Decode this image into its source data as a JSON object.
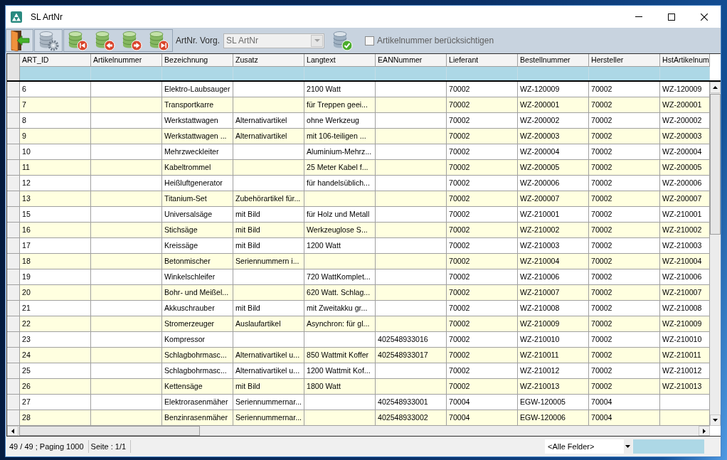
{
  "window": {
    "title": "SL ArtNr"
  },
  "toolbar": {
    "field_label": "ArtNr. Vorg.",
    "combo": {
      "value": "SL ArtNr",
      "disabled": true
    },
    "checkbox": {
      "label": "Artikelnummer berücksichtigen",
      "checked": false
    }
  },
  "table": {
    "columns": [
      "ART_ID",
      "Artikelnummer",
      "Bezeichnung",
      "Zusatz",
      "Langtext",
      "EANNummer",
      "Lieferant",
      "Bestellnummer",
      "Hersteller",
      "HstArtikelnum"
    ],
    "rows": [
      {
        "art_id": "6",
        "bezeichnung": "Elektro-Laubsauger",
        "langtext": "2100 Watt",
        "lieferant": "70002",
        "bestellnummer": "WZ-120009",
        "hersteller": "70002",
        "hst_artikelnum": "WZ-120009"
      },
      {
        "art_id": "7",
        "bezeichnung": "Transportkarre",
        "langtext": "für Treppen geei...",
        "lieferant": "70002",
        "bestellnummer": "WZ-200001",
        "hersteller": "70002",
        "hst_artikelnum": "WZ-200001"
      },
      {
        "art_id": "8",
        "bezeichnung": "Werkstattwagen",
        "zusatz": "Alternativartikel",
        "langtext": "ohne Werkzeug",
        "lieferant": "70002",
        "bestellnummer": "WZ-200002",
        "hersteller": "70002",
        "hst_artikelnum": "WZ-200002"
      },
      {
        "art_id": "9",
        "bezeichnung": "Werkstattwagen ...",
        "zusatz": "Alternativartikel",
        "langtext": "mit 106-teiligen ...",
        "lieferant": "70002",
        "bestellnummer": "WZ-200003",
        "hersteller": "70002",
        "hst_artikelnum": "WZ-200003"
      },
      {
        "art_id": "10",
        "bezeichnung": "Mehrzweckleiter",
        "langtext": "Aluminium-Mehrz...",
        "lieferant": "70002",
        "bestellnummer": "WZ-200004",
        "hersteller": "70002",
        "hst_artikelnum": "WZ-200004"
      },
      {
        "art_id": "11",
        "bezeichnung": "Kabeltrommel",
        "langtext": "25 Meter Kabel f...",
        "lieferant": "70002",
        "bestellnummer": "WZ-200005",
        "hersteller": "70002",
        "hst_artikelnum": "WZ-200005"
      },
      {
        "art_id": "12",
        "bezeichnung": "Heißluftgenerator",
        "langtext": "für handelsüblich...",
        "lieferant": "70002",
        "bestellnummer": "WZ-200006",
        "hersteller": "70002",
        "hst_artikelnum": "WZ-200006"
      },
      {
        "art_id": "13",
        "bezeichnung": "Titanium-Set",
        "zusatz": "Zubehörartikel für...",
        "lieferant": "70002",
        "bestellnummer": "WZ-200007",
        "hersteller": "70002",
        "hst_artikelnum": "WZ-200007"
      },
      {
        "art_id": "15",
        "bezeichnung": "Universalsäge",
        "zusatz": "mit Bild",
        "langtext": "für Holz und Metall",
        "lieferant": "70002",
        "bestellnummer": "WZ-210001",
        "hersteller": "70002",
        "hst_artikelnum": "WZ-210001"
      },
      {
        "art_id": "16",
        "bezeichnung": "Stichsäge",
        "zusatz": "mit Bild",
        "langtext": "Werkzeuglose S...",
        "lieferant": "70002",
        "bestellnummer": "WZ-210002",
        "hersteller": "70002",
        "hst_artikelnum": "WZ-210002"
      },
      {
        "art_id": "17",
        "bezeichnung": "Kreissäge",
        "zusatz": "mit Bild",
        "langtext": "1200 Watt",
        "lieferant": "70002",
        "bestellnummer": "WZ-210003",
        "hersteller": "70002",
        "hst_artikelnum": "WZ-210003"
      },
      {
        "art_id": "18",
        "bezeichnung": "Betonmischer",
        "zusatz": "Seriennummern i...",
        "lieferant": "70002",
        "bestellnummer": "WZ-210004",
        "hersteller": "70002",
        "hst_artikelnum": "WZ-210004"
      },
      {
        "art_id": "19",
        "bezeichnung": "Winkelschleifer",
        "langtext": "720 WattKomplet...",
        "lieferant": "70002",
        "bestellnummer": "WZ-210006",
        "hersteller": "70002",
        "hst_artikelnum": "WZ-210006"
      },
      {
        "art_id": "20",
        "bezeichnung": "Bohr- und Meißel...",
        "langtext": "620 Watt. Schlag...",
        "lieferant": "70002",
        "bestellnummer": "WZ-210007",
        "hersteller": "70002",
        "hst_artikelnum": "WZ-210007"
      },
      {
        "art_id": "21",
        "bezeichnung": "Akkuschrauber",
        "zusatz": "mit Bild",
        "langtext": "mit Zweitakku gr...",
        "lieferant": "70002",
        "bestellnummer": "WZ-210008",
        "hersteller": "70002",
        "hst_artikelnum": "WZ-210008"
      },
      {
        "art_id": "22",
        "bezeichnung": "Stromerzeuger",
        "zusatz": "Auslaufartikel",
        "langtext": "Asynchron: für gl...",
        "lieferant": "70002",
        "bestellnummer": "WZ-210009",
        "hersteller": "70002",
        "hst_artikelnum": "WZ-210009"
      },
      {
        "art_id": "23",
        "bezeichnung": "Kompressor",
        "ean_nummer": "402548933016",
        "lieferant": "70002",
        "bestellnummer": "WZ-210010",
        "hersteller": "70002",
        "hst_artikelnum": "WZ-210010"
      },
      {
        "art_id": "24",
        "bezeichnung": "Schlagbohrmasc...",
        "zusatz": "Alternativartikel u...",
        "langtext": "850 Wattmit Koffer",
        "ean_nummer": "402548933017",
        "lieferant": "70002",
        "bestellnummer": "WZ-210011",
        "hersteller": "70002",
        "hst_artikelnum": "WZ-210011"
      },
      {
        "art_id": "25",
        "bezeichnung": "Schlagbohrmasc...",
        "zusatz": "Alternativartikel u...",
        "langtext": "1200 Wattmit Kof...",
        "lieferant": "70002",
        "bestellnummer": "WZ-210012",
        "hersteller": "70002",
        "hst_artikelnum": "WZ-210012"
      },
      {
        "art_id": "26",
        "bezeichnung": "Kettensäge",
        "zusatz": "mit Bild",
        "langtext": "1800 Watt",
        "lieferant": "70002",
        "bestellnummer": "WZ-210013",
        "hersteller": "70002",
        "hst_artikelnum": "WZ-210013"
      },
      {
        "art_id": "27",
        "bezeichnung": "Elektrorasenmäher",
        "zusatz": "Seriennummernar...",
        "ean_nummer": "402548933001",
        "lieferant": "70004",
        "bestellnummer": "EGW-120005",
        "hersteller": "70004"
      },
      {
        "art_id": "28",
        "bezeichnung": "Benzinrasenmäher",
        "zusatz": "Seriennummernar...",
        "ean_nummer": "402548933002",
        "lieferant": "70004",
        "bestellnummer": "EGW-120006",
        "hersteller": "70004"
      }
    ]
  },
  "status_bar": {
    "record_info": "49 / 49 ; Paging 1000",
    "page_info": "Seite : 1/1",
    "field_filter": "<Alle Felder>"
  }
}
